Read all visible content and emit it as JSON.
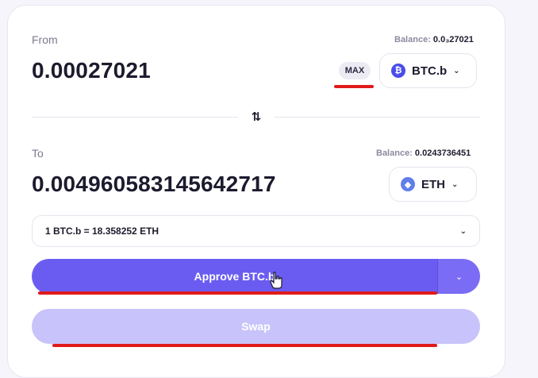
{
  "from": {
    "label": "From",
    "balance_label": "Balance:",
    "balance_value": "0.0₃27021",
    "amount": "0.00027021",
    "max_label": "MAX",
    "token": "BTC.b",
    "token_icon": "bitcoin-icon",
    "token_color": "#4a4de8"
  },
  "switch_icon": "⇅",
  "to": {
    "label": "To",
    "balance_label": "Balance:",
    "balance_value": "0.0243736451",
    "amount": "0.00496058314564​2717",
    "token": "ETH",
    "token_icon": "ethereum-icon",
    "token_color": "#627eea"
  },
  "rate": {
    "text": "1 BTC.b = 18.358252 ETH"
  },
  "actions": {
    "approve_label": "Approve BTC.b",
    "swap_label": "Swap"
  },
  "colors": {
    "primary": "#6b5cf1",
    "disabled": "#c9c3fb",
    "annotation_red": "#e01b1b"
  }
}
